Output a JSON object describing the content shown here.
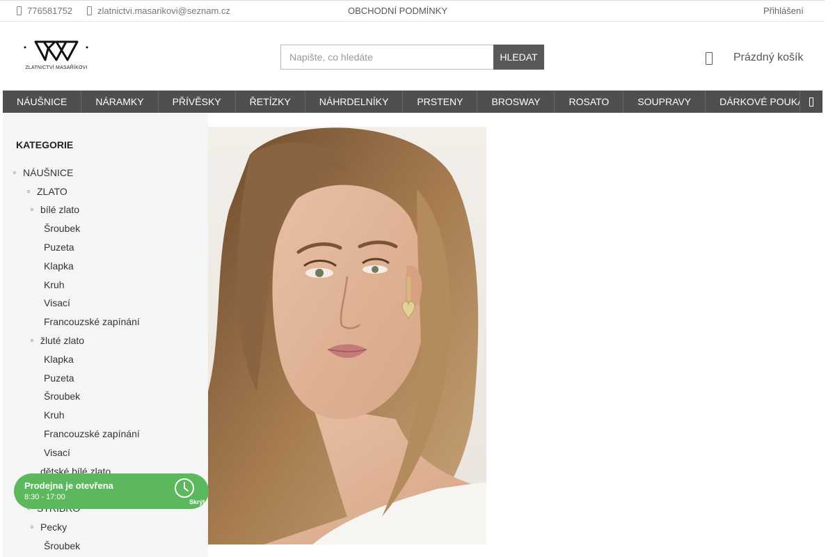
{
  "topbar": {
    "phone": "776581752",
    "email": "zlatnictvi.masarikovi@seznam.cz",
    "terms": "OBCHODNÍ PODMÍNKY",
    "login": "Přihlášení"
  },
  "logo": {
    "text": "ZLATNICTVÍ MASAŘÍKOVI"
  },
  "search": {
    "placeholder": "Napište, co hledáte",
    "button": "HLEDAT"
  },
  "cart": {
    "label": "Prázdný košík"
  },
  "nav": {
    "items": [
      "NÁUŠNICE",
      "NÁRAMKY",
      "PŘÍVĚSKY",
      "ŘETÍZKY",
      "NÁHRDELNÍKY",
      "PRSTENY",
      "BROSWAY",
      "ROSATO",
      "SOUPRAVY",
      "DÁRKOVÉ POUKAZY"
    ]
  },
  "sidebar": {
    "title": "KATEGORIE",
    "items": [
      "NÁUŠNICE",
      "ZLATO",
      "bílé zlato",
      "Šroubek",
      "Puzeta",
      "Klapka",
      "Kruh",
      "Visací",
      "Francouzské zapínání",
      "žluté zlato",
      "Klapka",
      "Puzeta",
      "Šroubek",
      "Kruh",
      "Francouzské zapínání",
      "Visací",
      "dětské bílé zlato",
      "STŘÍBRO",
      "Pecky",
      "Šroubek"
    ]
  },
  "shop_status": {
    "title": "Prodejna je otevřena",
    "hours": "8:30 - 17:00",
    "hide": "Skrýt"
  },
  "colors": {
    "nav_bg": "#4f4f4f",
    "search_button": "#595959",
    "open_badge": "#5cb85c",
    "sidebar_bg": "#f5f5f5"
  },
  "icons": [
    "phone-icon",
    "mail-icon",
    "bag-icon",
    "chevron-right-icon",
    "clock-icon"
  ]
}
